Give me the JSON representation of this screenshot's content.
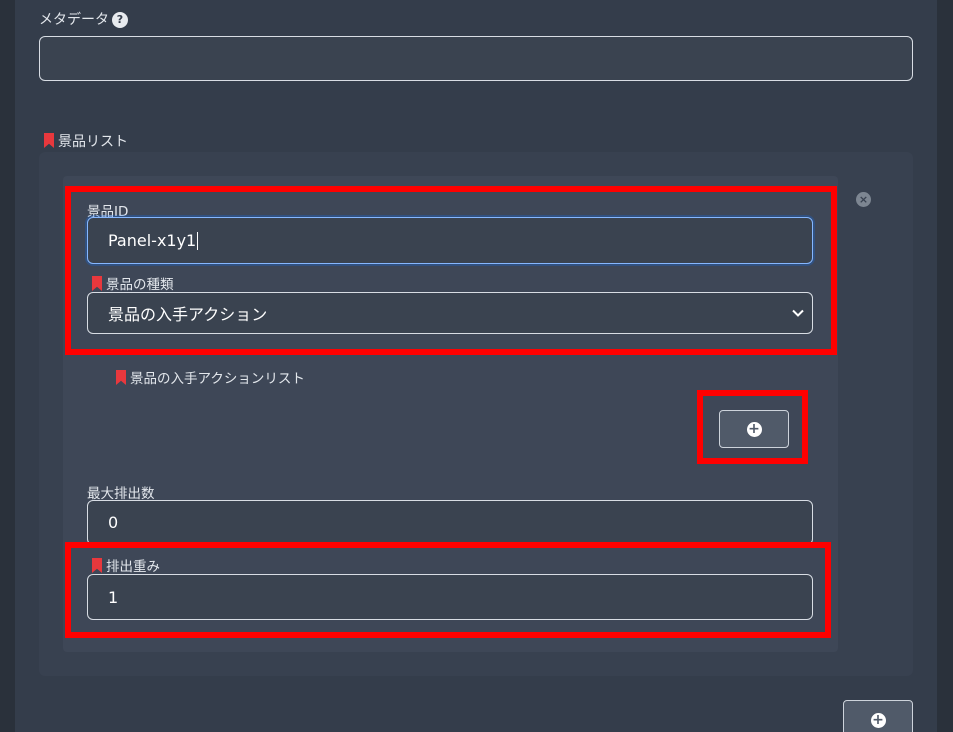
{
  "metadata": {
    "label": "メタデータ",
    "help": "?",
    "value": ""
  },
  "prize_list": {
    "label": "景品リスト",
    "item": {
      "close": "×",
      "prize_id": {
        "label": "景品ID",
        "value": "Panel-x1y1"
      },
      "prize_type": {
        "label": "景品の種類",
        "selected": "景品の入手アクション"
      },
      "acquire_actions": {
        "label": "景品の入手アクションリスト"
      },
      "max_count": {
        "label": "最大排出数",
        "value": "0"
      },
      "weight": {
        "label": "排出重み",
        "value": "1"
      }
    }
  },
  "icons": {
    "add": "+"
  },
  "colors": {
    "highlight": "#ff0000",
    "required_marker": "#e8383d",
    "focus": "#86b7fe"
  }
}
